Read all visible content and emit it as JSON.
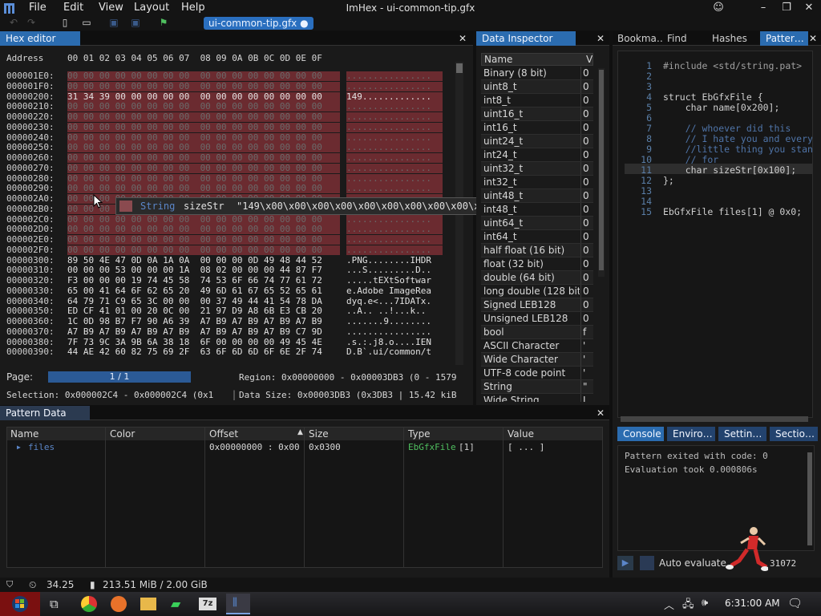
{
  "app": {
    "title": "ImHex - ui-common-tip.gfx"
  },
  "menu": [
    "File",
    "Edit",
    "View",
    "Layout",
    "Help"
  ],
  "file_tab": "ui-common-tip.gfx ●",
  "hex_editor": {
    "tab": "Hex editor",
    "address_label": "Address",
    "columns": "00 01 02 03 04 05 06 07  08 09 0A 0B 0C 0D 0E 0F",
    "rows": [
      {
        "addr": "000001E0:",
        "bytes": "00 00 00 00 00 00 00 00  00 00 00 00 00 00 00 00",
        "ascii": "................",
        "style": "zeros hl"
      },
      {
        "addr": "000001F0:",
        "bytes": "00 00 00 00 00 00 00 00  00 00 00 00 00 00 00 00",
        "ascii": "................",
        "style": "zeros hl"
      },
      {
        "addr": "00000200:",
        "bytes": "31 34 39 00 00 00 00 00  00 00 00 00 00 00 00 00",
        "ascii": "149.............",
        "style": "bytes"
      },
      {
        "addr": "00000210:",
        "bytes": "00 00 00 00 00 00 00 00  00 00 00 00 00 00 00 00",
        "ascii": "................",
        "style": "zeros"
      },
      {
        "addr": "00000220:",
        "bytes": "00 00 00 00 00 00 00 00  00 00 00 00 00 00 00 00",
        "ascii": "................",
        "style": "zeros"
      },
      {
        "addr": "00000230:",
        "bytes": "00 00 00 00 00 00 00 00  00 00 00 00 00 00 00 00",
        "ascii": "................",
        "style": "zeros"
      },
      {
        "addr": "00000240:",
        "bytes": "00 00 00 00 00 00 00 00  00 00 00 00 00 00 00 00",
        "ascii": "................",
        "style": "zeros"
      },
      {
        "addr": "00000250:",
        "bytes": "00 00 00 00 00 00 00 00  00 00 00 00 00 00 00 00",
        "ascii": "................",
        "style": "zeros"
      },
      {
        "addr": "00000260:",
        "bytes": "00 00 00 00 00 00 00 00  00 00 00 00 00 00 00 00",
        "ascii": "................",
        "style": "zeros"
      },
      {
        "addr": "00000270:",
        "bytes": "00 00 00 00 00 00 00 00  00 00 00 00 00 00 00 00",
        "ascii": "................",
        "style": "zeros"
      },
      {
        "addr": "00000280:",
        "bytes": "00 00 00 00 00 00 00 00  00 00 00 00 00 00 00 00",
        "ascii": "................",
        "style": "zeros"
      },
      {
        "addr": "00000290:",
        "bytes": "00 00 00 00 00 00 00 00  00 00 00 00 00 00 00 00",
        "ascii": "................",
        "style": "zeros"
      },
      {
        "addr": "000002A0:",
        "bytes": "00 00 00 00 00 00 00 00  00 00 00 00 00 00 00 00",
        "ascii": "................",
        "style": "zeros"
      },
      {
        "addr": "000002B0:",
        "bytes": "00 00 00 00 00 00 00 00  00 00 00 00 00 00 00 00",
        "ascii": "................",
        "style": "zeros"
      },
      {
        "addr": "000002C0:",
        "bytes": "00 00 00 00 00 00 00 00  00 00 00 00 00 00 00 00",
        "ascii": "................",
        "style": "zeros"
      },
      {
        "addr": "000002D0:",
        "bytes": "00 00 00 00 00 00 00 00  00 00 00 00 00 00 00 00",
        "ascii": "................",
        "style": "zeros"
      },
      {
        "addr": "000002E0:",
        "bytes": "00 00 00 00 00 00 00 00  00 00 00 00 00 00 00 00",
        "ascii": "................",
        "style": "zeros"
      },
      {
        "addr": "000002F0:",
        "bytes": "00 00 00 00 00 00 00 00  00 00 00 00 00 00 00 00",
        "ascii": "................",
        "style": "zeros"
      },
      {
        "addr": "00000300:",
        "bytes": "89 50 4E 47 0D 0A 1A 0A  00 00 00 0D 49 48 44 52",
        "ascii": ".PNG........IHDR",
        "style": "bytes"
      },
      {
        "addr": "00000310:",
        "bytes": "00 00 00 53 00 00 00 1A  08 02 00 00 00 44 87 F7",
        "ascii": "...S.........D..",
        "style": "bytes"
      },
      {
        "addr": "00000320:",
        "bytes": "F3 00 00 00 19 74 45 58  74 53 6F 66 74 77 61 72",
        "ascii": ".....tEXtSoftwar",
        "style": "bytes"
      },
      {
        "addr": "00000330:",
        "bytes": "65 00 41 64 6F 62 65 20  49 6D 61 67 65 52 65 61",
        "ascii": "e.Adobe ImageRea",
        "style": "bytes"
      },
      {
        "addr": "00000340:",
        "bytes": "64 79 71 C9 65 3C 00 00  00 37 49 44 41 54 78 DA",
        "ascii": "dyq.e<...7IDATx.",
        "style": "bytes"
      },
      {
        "addr": "00000350:",
        "bytes": "ED CF 41 01 00 20 0C 00  21 97 D9 A8 6B E3 CB 20",
        "ascii": "..A.. ..!...k.. ",
        "style": "bytes"
      },
      {
        "addr": "00000360:",
        "bytes": "1C 0D 98 B7 F7 90 A6 39  A7 B9 A7 B9 A7 B9 A7 B9",
        "ascii": ".......9........",
        "style": "bytes"
      },
      {
        "addr": "00000370:",
        "bytes": "A7 B9 A7 B9 A7 B9 A7 B9  A7 B9 A7 B9 A7 B9 C7 9D",
        "ascii": "................",
        "style": "bytes"
      },
      {
        "addr": "00000380:",
        "bytes": "7F 73 9C 3A 9B 6A 38 18  6F 00 00 00 00 49 45 4E",
        "ascii": ".s.:.j8.o....IEN",
        "style": "bytes"
      },
      {
        "addr": "00000390:",
        "bytes": "44 AE 42 60 82 75 69 2F  63 6F 6D 6D 6F 6E 2F 74",
        "ascii": "D.B`.ui/common/t",
        "style": "bytes"
      }
    ],
    "page_label": "Page:",
    "page_value": "1 / 1",
    "region": "Region: 0x00000000 - 0x00003DB3 (0 - 1579",
    "selection": "Selection: 0x000002C4 - 0x000002C4 (0x1",
    "data_size": "Data Size: 0x00003DB3 (0x3DB3 | 15.42 kiB",
    "tooltip": {
      "type": "String",
      "name": "sizeStr",
      "value": "\"149\\x00\\x00\\x00\\x00\\x00\\x00\\x00\\x00\\x00\\x00\\x00\\x00\\..."
    }
  },
  "inspector": {
    "tab": "Data Inspector",
    "header_name": "Name",
    "header_value": "V",
    "rows": [
      {
        "name": "Binary (8 bit)",
        "value": "0"
      },
      {
        "name": "uint8_t",
        "value": "0"
      },
      {
        "name": "int8_t",
        "value": "0"
      },
      {
        "name": "uint16_t",
        "value": "0"
      },
      {
        "name": "int16_t",
        "value": "0"
      },
      {
        "name": "uint24_t",
        "value": "0"
      },
      {
        "name": "int24_t",
        "value": "0"
      },
      {
        "name": "uint32_t",
        "value": "0"
      },
      {
        "name": "int32_t",
        "value": "0"
      },
      {
        "name": "uint48_t",
        "value": "0"
      },
      {
        "name": "int48_t",
        "value": "0"
      },
      {
        "name": "uint64_t",
        "value": "0"
      },
      {
        "name": "int64_t",
        "value": "0"
      },
      {
        "name": "half float (16 bit)",
        "value": "0"
      },
      {
        "name": "float (32 bit)",
        "value": "0"
      },
      {
        "name": "double (64 bit)",
        "value": "0"
      },
      {
        "name": "long double (128 bit)",
        "value": "0"
      },
      {
        "name": "Signed LEB128",
        "value": "0"
      },
      {
        "name": "Unsigned LEB128",
        "value": "0"
      },
      {
        "name": "bool",
        "value": "f"
      },
      {
        "name": "ASCII Character",
        "value": "'"
      },
      {
        "name": "Wide Character",
        "value": "'"
      },
      {
        "name": "UTF-8 code point",
        "value": "'"
      },
      {
        "name": "String",
        "value": "\""
      },
      {
        "name": "Wide String",
        "value": "L"
      }
    ]
  },
  "pattern_tabs": [
    "Bookma…",
    "Find",
    "Hashes",
    "Patter…"
  ],
  "code_lines": [
    {
      "n": "1",
      "text": "#include <std/string.pat>",
      "cls": "pre"
    },
    {
      "n": "2",
      "text": "",
      "cls": ""
    },
    {
      "n": "3",
      "text": "",
      "cls": ""
    },
    {
      "n": "4",
      "text": "struct EbGfxFile {",
      "cls": "kw"
    },
    {
      "n": "5",
      "text": "    char name[0x200];",
      "cls": "kw"
    },
    {
      "n": "6",
      "text": "",
      "cls": ""
    },
    {
      "n": "7",
      "text": "    // whoever did this",
      "cls": "cm"
    },
    {
      "n": "8",
      "text": "    // I hate you and every",
      "cls": "cm"
    },
    {
      "n": "9",
      "text": "    //little thing you stand",
      "cls": "cm"
    },
    {
      "n": "10",
      "text": "    // for",
      "cls": "cm"
    },
    {
      "n": "11",
      "text": "    char sizeStr[0x100];",
      "cls": "kw"
    },
    {
      "n": "12",
      "text": "};",
      "cls": ""
    },
    {
      "n": "13",
      "text": "",
      "cls": ""
    },
    {
      "n": "14",
      "text": "",
      "cls": ""
    },
    {
      "n": "15",
      "text": "EbGfxFile files[1] @ 0x0;",
      "cls": ""
    }
  ],
  "pattern_data": {
    "tab": "Pattern Data",
    "headers": [
      "Name",
      "Color",
      "Offset",
      "Size",
      "Type",
      "Value"
    ],
    "row": {
      "name": "files",
      "offset": "0x00000000 : 0x00",
      "size": "0x0300",
      "type_name": "EbGfxFile",
      "type_suffix": "[1]",
      "value": "[ ... ]"
    }
  },
  "console": {
    "tabs": [
      "Console",
      "Enviro…",
      "Settin…",
      "Sectio…"
    ],
    "lines": [
      "Pattern exited with code: 0",
      "Evaluation took 0.000806s"
    ],
    "auto_evaluate": "Auto evaluate",
    "counter": "31072"
  },
  "status": {
    "fps": "34.25",
    "memory": "213.51 MiB / 2.00 GiB"
  },
  "taskbar": {
    "clock": "6:31:00 AM"
  },
  "colors": {
    "accent": "#2b6cb0",
    "highlight": "#6b2b30",
    "keyword": "#5b86c8",
    "comment": "#4f74a8",
    "number": "#d0a030"
  }
}
